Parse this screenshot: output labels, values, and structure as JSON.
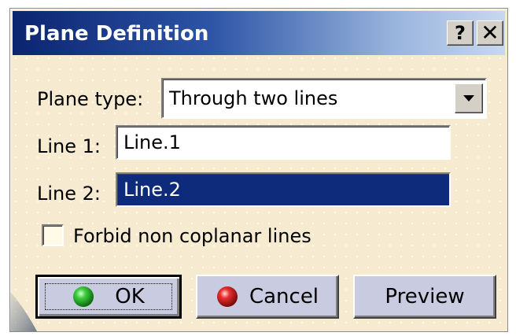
{
  "window": {
    "title": "Plane Definition",
    "help_label": "?",
    "close_label": "✕"
  },
  "form": {
    "plane_type_label": "Plane type:",
    "plane_type_value": "Through two lines",
    "line1_label": "Line 1:",
    "line1_value": "Line.1",
    "line2_label": "Line 2:",
    "line2_value": "Line.2",
    "forbid_label": "Forbid non coplanar lines",
    "forbid_checked": false
  },
  "buttons": {
    "ok_label": "OK",
    "cancel_label": "Cancel",
    "preview_label": "Preview"
  },
  "icons": {
    "ok": "green-ball-icon",
    "cancel": "red-ball-icon",
    "dropdown": "dropdown-arrow-icon"
  },
  "colors": {
    "titlebar_start": "#0b2470",
    "titlebar_end": "#c8d8ee",
    "dialog_bg": "#f6ebd0",
    "selected_field_bg": "#0e2a7a",
    "button_face": "#c9cbe0"
  }
}
